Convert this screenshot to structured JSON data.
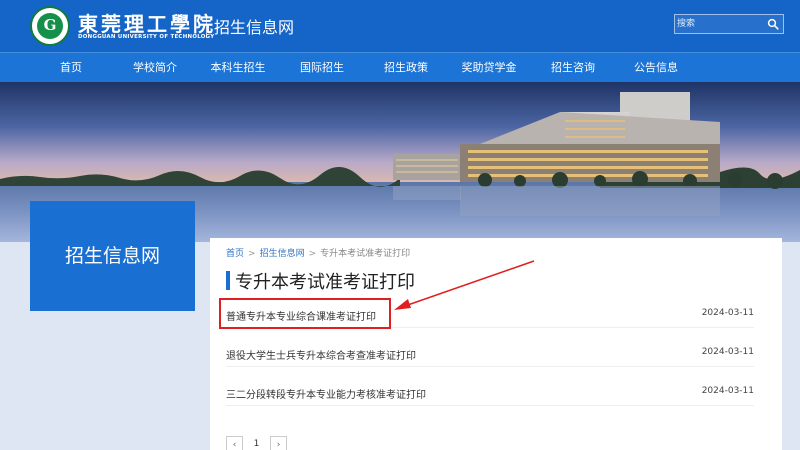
{
  "header": {
    "logo_letter": "G",
    "school_name_cn": "東莞理工學院",
    "school_name_en": "DONGGUAN UNIVERSITY OF TECHNOLOGY",
    "site_title": "招生信息网",
    "search_placeholder": "搜索",
    "colors": {
      "header_bg": "#1565c8",
      "nav_bg": "#1b74d6",
      "sidebar_bg": "#1a70d2"
    }
  },
  "nav": {
    "items": [
      {
        "label": "首页"
      },
      {
        "label": "学校简介"
      },
      {
        "label": "本科生招生"
      },
      {
        "label": "国际招生"
      },
      {
        "label": "招生政策"
      },
      {
        "label": "奖助贷学金"
      },
      {
        "label": "招生咨询"
      },
      {
        "label": "公告信息"
      }
    ]
  },
  "sidebar": {
    "title": "招生信息网"
  },
  "breadcrumb": {
    "items": [
      {
        "label": "首页"
      },
      {
        "label": "招生信息网"
      },
      {
        "label": "专升本考试准考证打印"
      }
    ],
    "separator": ">"
  },
  "main": {
    "page_title": "专升本考试准考证打印",
    "list": [
      {
        "title": "普通专升本专业综合课准考证打印",
        "date": "2024-03-11"
      },
      {
        "title": "退役大学生士兵专升本综合考查准考证打印",
        "date": "2024-03-11"
      },
      {
        "title": "三二分段转段专升本专业能力考核准考证打印",
        "date": "2024-03-11"
      }
    ],
    "pagination": {
      "prev": "‹",
      "current": "1",
      "next": "›"
    }
  },
  "annotation": {
    "color": "#e02020"
  }
}
